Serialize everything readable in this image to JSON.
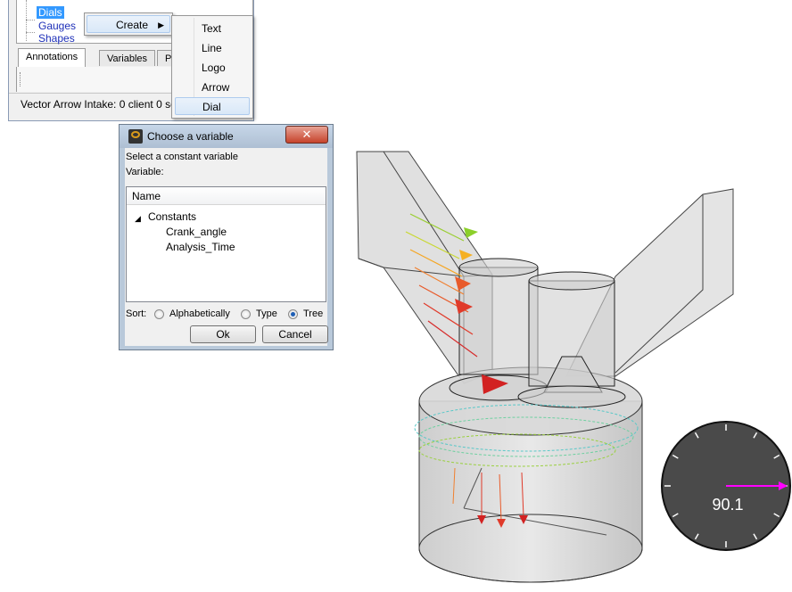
{
  "panel": {
    "tree_items": [
      {
        "label": "Dials",
        "selected": true
      },
      {
        "label": "Gauges",
        "selected": false
      },
      {
        "label": "Shapes",
        "selected": false
      }
    ],
    "tabs": [
      "Annotations",
      "Variables",
      "Plo"
    ],
    "active_tab": "Annotations",
    "status_text": "Vector Arrow Intake: 0 client 0 se"
  },
  "context_menu": {
    "item": "Create",
    "submenu": [
      "Text",
      "Line",
      "Logo",
      "Arrow",
      "Dial"
    ],
    "highlighted": "Dial"
  },
  "dialog": {
    "title": "Choose a variable",
    "close_glyph": "✕",
    "instruction": "Select a constant variable",
    "variable_label": "Variable:",
    "column_header": "Name",
    "tree": {
      "group": "Constants",
      "children": [
        "Crank_angle",
        "Analysis_Time"
      ]
    },
    "sort_label": "Sort:",
    "sort_options": [
      {
        "label": "Alphabetically",
        "selected": false
      },
      {
        "label": "Type",
        "selected": false
      },
      {
        "label": "Tree",
        "selected": true
      }
    ],
    "ok_label": "Ok",
    "cancel_label": "Cancel"
  },
  "dial": {
    "value": "90.1",
    "needle_color": "#ff00ff",
    "face_color": "#4a4a4a"
  },
  "colors": {
    "selection": "#3399ff",
    "link_text": "#1d2fb8"
  }
}
